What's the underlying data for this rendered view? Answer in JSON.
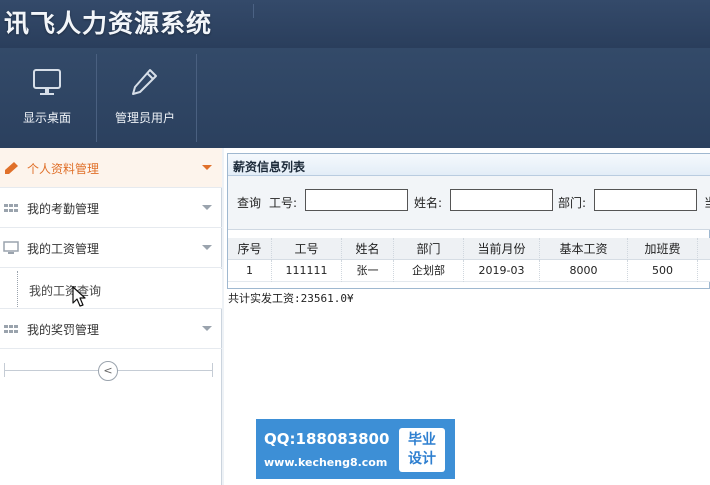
{
  "app": {
    "title": "讯飞人力资源系统"
  },
  "toolbar": {
    "items": [
      {
        "label": "显示桌面",
        "icon": "monitor-icon"
      },
      {
        "label": "管理员用户",
        "icon": "pencil-icon"
      }
    ]
  },
  "sidebar": {
    "items": [
      {
        "label": "个人资料管理",
        "icon": "pencil-icon",
        "active": true
      },
      {
        "label": "我的考勤管理",
        "icon": "grid-icon",
        "active": false
      },
      {
        "label": "我的工资管理",
        "icon": "monitor-icon",
        "active": false
      },
      {
        "label": "我的奖罚管理",
        "icon": "grid-icon",
        "active": false
      }
    ],
    "submenu": {
      "label": "我的工资查询"
    },
    "collapse_glyph": "<",
    "colors": {
      "active_text": "#e0702a",
      "active_bg": "#fdf4ec"
    }
  },
  "panel": {
    "title": "薪资信息列表",
    "search": {
      "query_label": "查询",
      "id_label": "工号:",
      "id_value": "",
      "name_label": "姓名:",
      "name_value": "",
      "dept_label": "部门:",
      "dept_value": "",
      "month_label": "当"
    },
    "columns": [
      "序号",
      "工号",
      "姓名",
      "部门",
      "当前月份",
      "基本工资",
      "加班费"
    ],
    "rows": [
      [
        "1",
        "111111",
        "张一",
        "企划部",
        "2019-03",
        "8000",
        "500"
      ]
    ],
    "total": "共计实发工资:23561.0¥"
  },
  "watermark": {
    "qq": "QQ:188083800",
    "url": "www.kecheng8.com",
    "badge": "毕业\n设计",
    "color": "#3d8fd6"
  }
}
